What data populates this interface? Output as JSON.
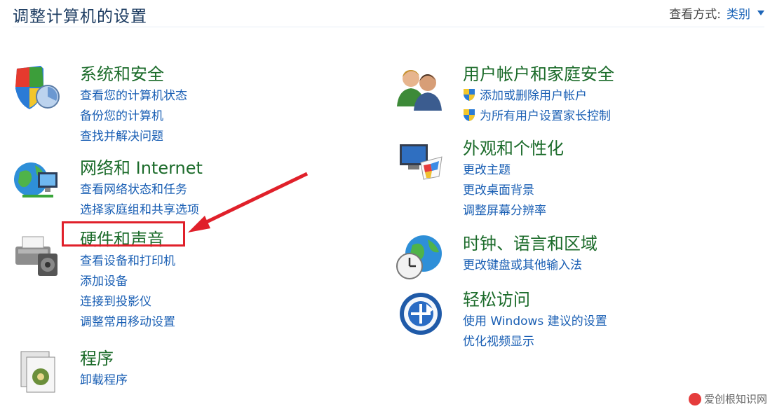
{
  "header": {
    "title": "调整计算机的设置",
    "view_by_label": "查看方式:",
    "view_by_value": "类别"
  },
  "left": [
    {
      "title": "系统和安全",
      "links": [
        "查看您的计算机状态",
        "备份您的计算机",
        "查找并解决问题"
      ]
    },
    {
      "title": "网络和 Internet",
      "links": [
        "查看网络状态和任务",
        "选择家庭组和共享选项"
      ]
    },
    {
      "title": "硬件和声音",
      "links": [
        "查看设备和打印机",
        "添加设备",
        "连接到投影仪",
        "调整常用移动设置"
      ]
    },
    {
      "title": "程序",
      "links": [
        "卸载程序"
      ]
    }
  ],
  "right": [
    {
      "title": "用户帐户和家庭安全",
      "links": [
        "添加或删除用户帐户",
        "为所有用户设置家长控制"
      ]
    },
    {
      "title": "外观和个性化",
      "links": [
        "更改主题",
        "更改桌面背景",
        "调整屏幕分辨率"
      ]
    },
    {
      "title": "时钟、语言和区域",
      "links": [
        "更改键盘或其他输入法"
      ]
    },
    {
      "title": "轻松访问",
      "links": [
        "使用 Windows 建议的设置",
        "优化视频显示"
      ]
    }
  ],
  "watermark": "爱创根知识网",
  "icons": {
    "system": "shield-icon",
    "network": "globe-network-icon",
    "hardware": "printer-icon",
    "programs": "programs-icon",
    "users": "users-icon",
    "appearance": "monitor-palette-icon",
    "clock": "globe-clock-icon",
    "ease": "ease-of-access-icon",
    "shield_small": "uac-shield-icon"
  },
  "colors": {
    "category_title": "#1b6b2a",
    "link": "#1a5fb4",
    "highlight": "#e0202a"
  }
}
